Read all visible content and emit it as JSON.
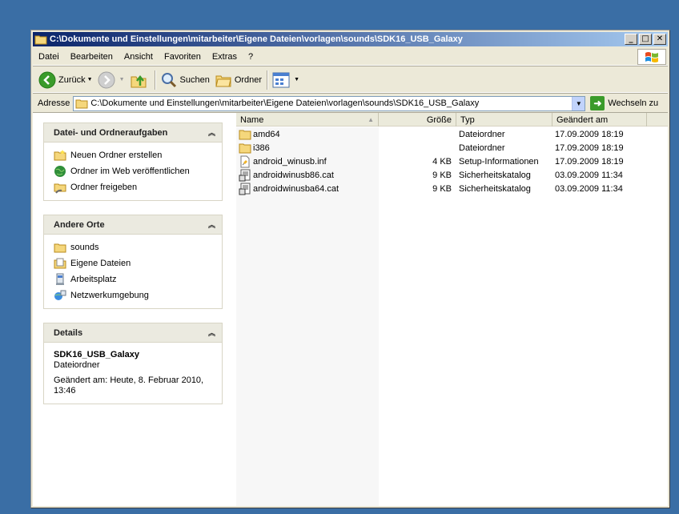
{
  "window": {
    "title": "C:\\Dokumente und Einstellungen\\mitarbeiter\\Eigene Dateien\\vorlagen\\sounds\\SDK16_USB_Galaxy",
    "controls": {
      "minimize": "_",
      "maximize": "□",
      "close": "✕"
    }
  },
  "menu": {
    "items": [
      "Datei",
      "Bearbeiten",
      "Ansicht",
      "Favoriten",
      "Extras",
      "?"
    ]
  },
  "toolbar": {
    "back_label": "Zurück",
    "search_label": "Suchen",
    "folders_label": "Ordner"
  },
  "address": {
    "label": "Adresse",
    "value": "C:\\Dokumente und Einstellungen\\mitarbeiter\\Eigene Dateien\\vorlagen\\sounds\\SDK16_USB_Galaxy",
    "go_label": "Wechseln zu"
  },
  "sidebar": {
    "tasks": {
      "title": "Datei- und Ordneraufgaben",
      "items": [
        "Neuen Ordner erstellen",
        "Ordner im Web veröffentlichen",
        "Ordner freigeben"
      ]
    },
    "places": {
      "title": "Andere Orte",
      "items": [
        "sounds",
        "Eigene Dateien",
        "Arbeitsplatz",
        "Netzwerkumgebung"
      ]
    },
    "details": {
      "title": "Details",
      "name": "SDK16_USB_Galaxy",
      "kind": "Dateiordner",
      "modified": "Geändert am: Heute, 8. Februar 2010, 13:46"
    }
  },
  "filelist": {
    "columns": {
      "name": "Name",
      "size": "Größe",
      "type": "Typ",
      "date": "Geändert am"
    },
    "rows": [
      {
        "name": "amd64",
        "size": "",
        "type": "Dateiordner",
        "date": "17.09.2009 18:19",
        "icon": "folder-icon"
      },
      {
        "name": "i386",
        "size": "",
        "type": "Dateiordner",
        "date": "17.09.2009 18:19",
        "icon": "folder-icon"
      },
      {
        "name": "android_winusb.inf",
        "size": "4 KB",
        "type": "Setup-Informationen",
        "date": "17.09.2009 18:19",
        "icon": "inf-file-icon"
      },
      {
        "name": "androidwinusb86.cat",
        "size": "9 KB",
        "type": "Sicherheitskatalog",
        "date": "03.09.2009 11:34",
        "icon": "catalog-file-icon"
      },
      {
        "name": "androidwinusba64.cat",
        "size": "9 KB",
        "type": "Sicherheitskatalog",
        "date": "03.09.2009 11:34",
        "icon": "catalog-file-icon"
      }
    ]
  }
}
